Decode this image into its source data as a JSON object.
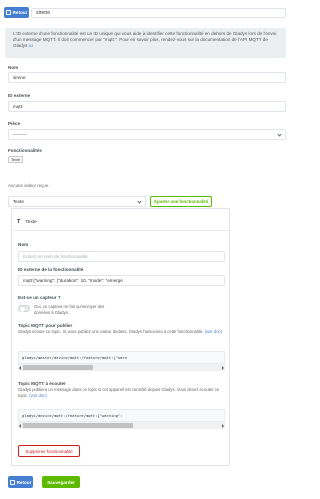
{
  "header": {
    "back_label": "Retour",
    "device_name": "sirene"
  },
  "info": {
    "text": "L'ID externe d'une fonctionnalité est un ID unique qui vous aide à identifier cette fonctionnalité en dehors de Gladys lors de l'envoi d'un message MQTT. Il doit commencer par \"mqtt:\". Pour en savoir plus, rendez-vous sur la documentation de l'API MQTT de Gladys",
    "link": "ici"
  },
  "form": {
    "name_label": "Nom",
    "name_value": "sirene",
    "external_id_label": "ID externe",
    "external_id_value": "mqtt:",
    "room_label": "Pièce",
    "room_value": "---------",
    "features_label": "Fonctionnalités",
    "feature_tag": "Texte"
  },
  "add_feature": {
    "no_value_label": "Aucune valeur reçue.",
    "select_value": "Texte",
    "add_button": "Ajouter une fonctionnalité"
  },
  "feature_card": {
    "title": "Texte",
    "name_label": "Nom",
    "name_placeholder": "Entrez un nom de fonctionnalité",
    "external_id_label": "ID externe de la fonctionnalité",
    "external_id_value": "mqtt:{\"warning\": {\"duration\": 10, \"mode\": \"emerge",
    "sensor_label": "Est-ce un capteur ?",
    "sensor_text": "Oui, ce capteur ne fait qu'envoyer des données à Gladys.",
    "publish_label": "Topic MQTT pour publier",
    "publish_desc": "Gladys écoute ce topic. Si vous publiez une valeur dedans, Gladys l'associera à cette fonctionnalité.",
    "publish_link": "(voir doc)",
    "publish_topic": "gladys/master/device/mqtt:/feature/mqtt:{\"warn",
    "listen_label": "Topic MQTT à écouter",
    "listen_desc": "Gladys publiera un message dans ce topic si cet appareil est contrôlé depuis Gladys. Vous devez écouter ce topic.",
    "listen_link": "(voir doc)",
    "listen_topic": "gladys/device/mqtt:/feature/mqtt:{\"warning\":",
    "delete_button": "Supprimer fonctionnalité"
  },
  "footer": {
    "back_label": "Retour",
    "save_label": "Sauvegarder"
  },
  "colors": {
    "primary": "#467fcf",
    "success": "#5eba00",
    "danger": "#cd201f",
    "info_bg": "#eceff1"
  }
}
